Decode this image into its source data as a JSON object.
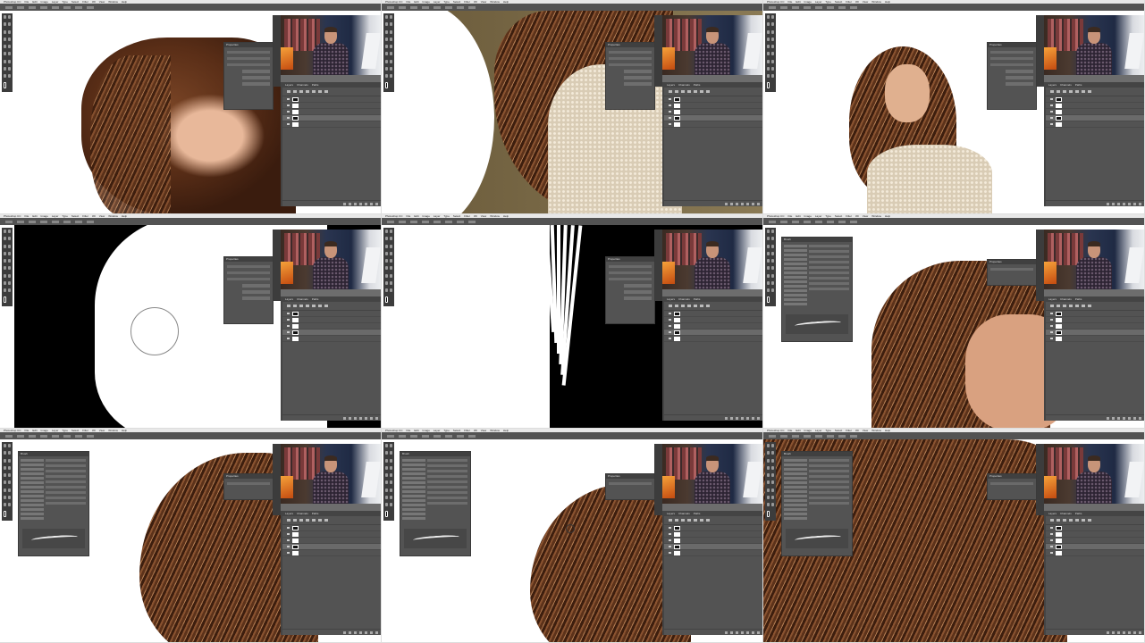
{
  "menu": [
    "Photoshop CC",
    "File",
    "Edit",
    "Image",
    "Layer",
    "Type",
    "Select",
    "Filter",
    "3D",
    "View",
    "Window",
    "Help"
  ],
  "panels": {
    "properties_title": "Properties",
    "brush_title": "Brush",
    "layers_tabs": [
      "Layers",
      "Channels",
      "Paths"
    ]
  },
  "tiles": [
    {
      "scene": "face-closeup",
      "panel": "properties"
    },
    {
      "scene": "shoulder-lace",
      "panel": "properties"
    },
    {
      "scene": "cutout-woman",
      "panel": "properties"
    },
    {
      "scene": "mask-blob",
      "panel": "properties"
    },
    {
      "scene": "mask-strands",
      "panel": "properties"
    },
    {
      "scene": "hair-face-right",
      "panel": "brush"
    },
    {
      "scene": "hair-top",
      "panel": "brush"
    },
    {
      "scene": "hair-top-2",
      "panel": "brush"
    },
    {
      "scene": "hair-full",
      "panel": "brush"
    }
  ],
  "colors": {
    "ui_dark": "#535353",
    "menubar": "#e8e8e8",
    "hair": "#5a2e17"
  }
}
